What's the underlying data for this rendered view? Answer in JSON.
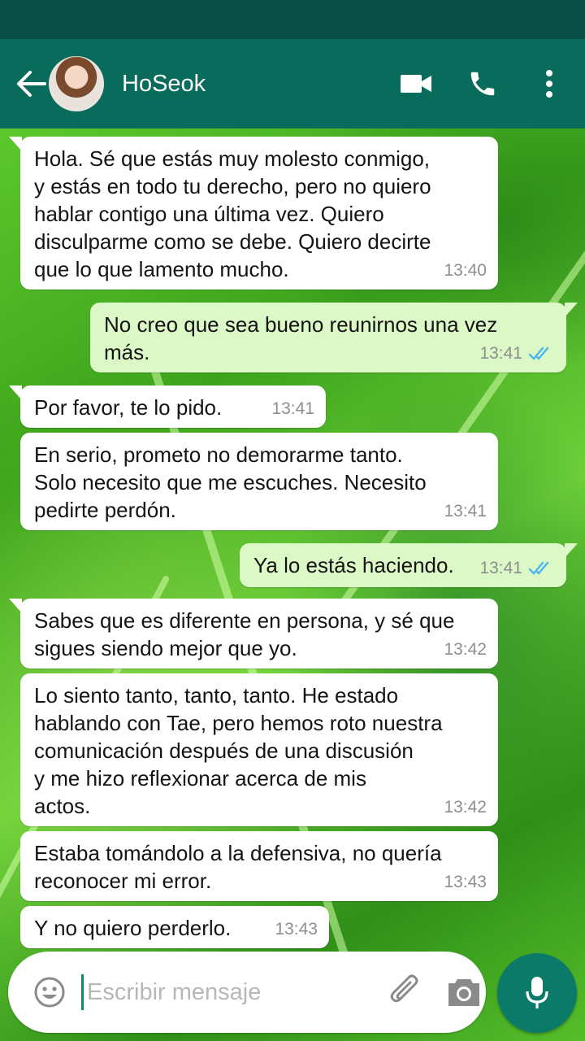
{
  "header": {
    "contact_name": "HoSeok",
    "icons": [
      "back-arrow-icon",
      "video-call-icon",
      "phone-call-icon",
      "more-vertical-icon"
    ]
  },
  "messages": [
    {
      "direction": "incoming",
      "text": "Hola. Sé que estás muy molesto conmigo,\ny estás en todo tu derecho, pero no quiero\nhablar contigo una última vez. Quiero\ndisculparme como se debe. Quiero decirte\nque lo que lamento mucho.",
      "time": "13:40"
    },
    {
      "direction": "outgoing",
      "text": "No creo que sea bueno reunirnos una vez\nmás.",
      "time": "13:41",
      "status": "read"
    },
    {
      "direction": "incoming",
      "text": "Por favor, te lo pido.",
      "time": "13:41"
    },
    {
      "direction": "incoming",
      "text": "En serio, prometo no demorarme tanto.\nSolo necesito que me escuches. Necesito\npedirte perdón.",
      "time": "13:41"
    },
    {
      "direction": "outgoing",
      "text": "Ya lo estás haciendo.",
      "time": "13:41",
      "status": "read"
    },
    {
      "direction": "incoming",
      "text": "Sabes que es diferente en persona, y sé que\nsigues siendo mejor que yo.",
      "time": "13:42"
    },
    {
      "direction": "incoming",
      "text": "Lo siento tanto, tanto, tanto. He estado\nhablando con Tae, pero hemos roto nuestra\ncomunicación después de una discusión\ny me hizo reflexionar acerca de mis\nactos.",
      "time": "13:42"
    },
    {
      "direction": "incoming",
      "text": "Estaba tomándolo a la defensiva, no quería\nreconocer mi error.",
      "time": "13:43"
    },
    {
      "direction": "incoming",
      "text": "Y no quiero perderlo.",
      "time": "13:43"
    }
  ],
  "composer": {
    "placeholder": "Escribir mensaje",
    "icons": [
      "emoji-icon",
      "attach-icon",
      "camera-icon",
      "mic-icon"
    ]
  },
  "colors": {
    "header": "#086b5b",
    "status_bar": "#0a4f45",
    "incoming_bubble": "#ffffff",
    "outgoing_bubble": "#dcf8c6",
    "read_ticks": "#4fb6ec",
    "mic_button": "#0b7a69"
  }
}
